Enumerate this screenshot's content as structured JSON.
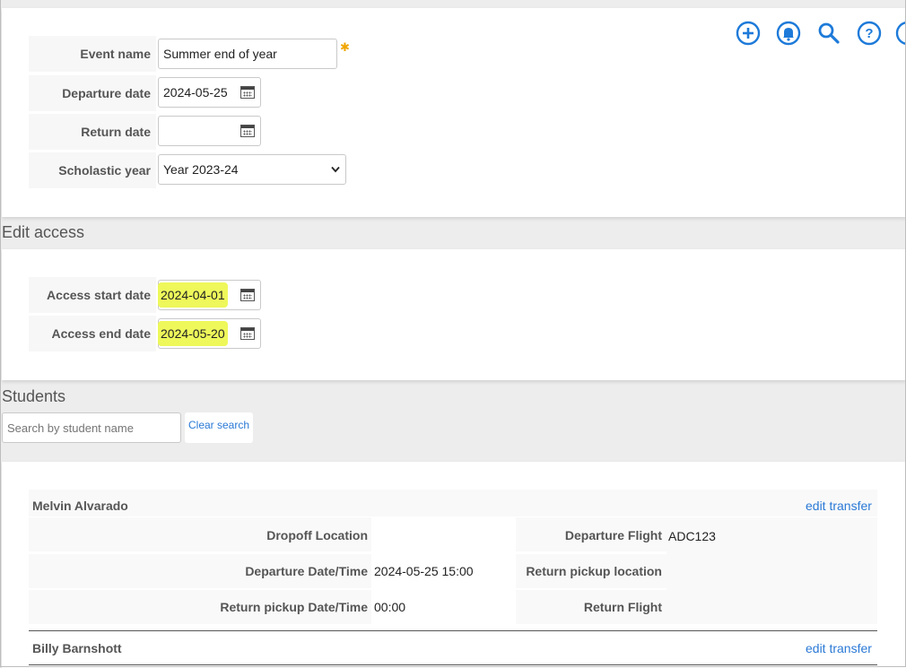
{
  "toolbar": {
    "icons": [
      "add-icon",
      "bell-icon",
      "search-icon",
      "help-icon",
      "chat-icon"
    ],
    "accent": "#1d7ad9"
  },
  "event": {
    "name_label": "Event name",
    "name_value": "Summer end of year",
    "required_mark": "✱",
    "departure_label": "Departure date",
    "departure_value": "2024-05-25",
    "return_label": "Return date",
    "return_value": "",
    "year_label": "Scholastic year",
    "year_value": "Year 2023-24"
  },
  "access": {
    "title": "Edit access",
    "start_label": "Access start date",
    "start_value": "2024-04-01",
    "end_label": "Access end date",
    "end_value": "2024-05-20",
    "highlight": "#eef85a"
  },
  "students": {
    "title": "Students",
    "search_placeholder": "Search by student name",
    "clear_label": "Clear search",
    "edit_label": "edit transfer",
    "list": [
      {
        "name": "Melvin Alvarado",
        "dropoff_label": "Dropoff Location",
        "dropoff_value": "",
        "dep_flight_label": "Departure Flight",
        "dep_flight_value": "ADC123",
        "dep_dt_label": "Departure Date/Time",
        "dep_dt_value": "2024-05-25 15:00",
        "ret_loc_label": "Return pickup location",
        "ret_loc_value": "",
        "ret_dt_label": "Return pickup Date/Time",
        "ret_dt_value": "00:00",
        "ret_flight_label": "Return Flight",
        "ret_flight_value": ""
      },
      {
        "name": "Billy Barnshott"
      }
    ]
  }
}
